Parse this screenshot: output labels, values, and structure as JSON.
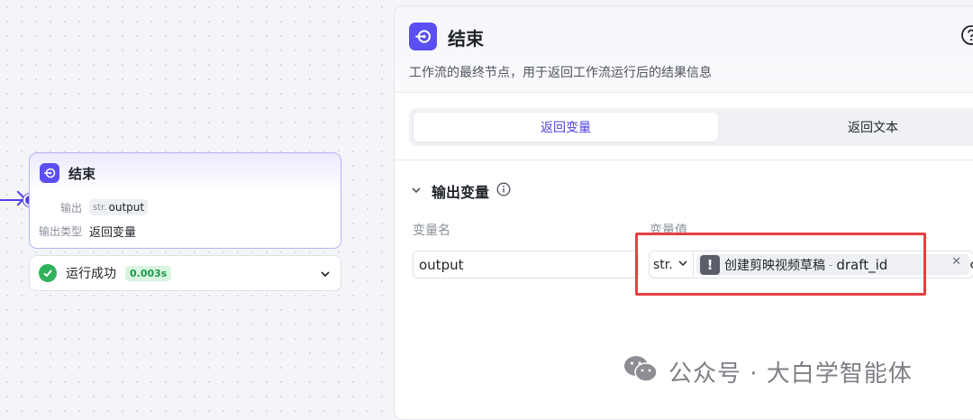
{
  "canvas": {
    "node": {
      "title": "结束",
      "output_label": "输出",
      "output_var_prefix": "str.",
      "output_var_name": "output",
      "type_label": "输出类型",
      "type_value": "返回变量"
    },
    "run_status": {
      "text": "运行成功",
      "duration": "0.003s"
    }
  },
  "panel": {
    "title": "结束",
    "description": "工作流的最终节点，用于返回工作流运行后的结果信息",
    "tabs": [
      {
        "label": "返回变量",
        "active": true
      },
      {
        "label": "返回文本",
        "active": false
      }
    ],
    "section_title": "输出变量",
    "columns": {
      "name": "变量名",
      "value": "变量值"
    },
    "row": {
      "name_value": "output",
      "type_value": "str.",
      "ref_node": "创建剪映视频草稿",
      "ref_separator": "-",
      "ref_variable": "draft_id"
    }
  },
  "watermark": {
    "text": "公众号 · 大白学智能体"
  },
  "colors": {
    "accent": "#4e40e5",
    "node_icon": "#5b4ef2",
    "success": "#2fb25a",
    "highlight": "#e5403f"
  }
}
